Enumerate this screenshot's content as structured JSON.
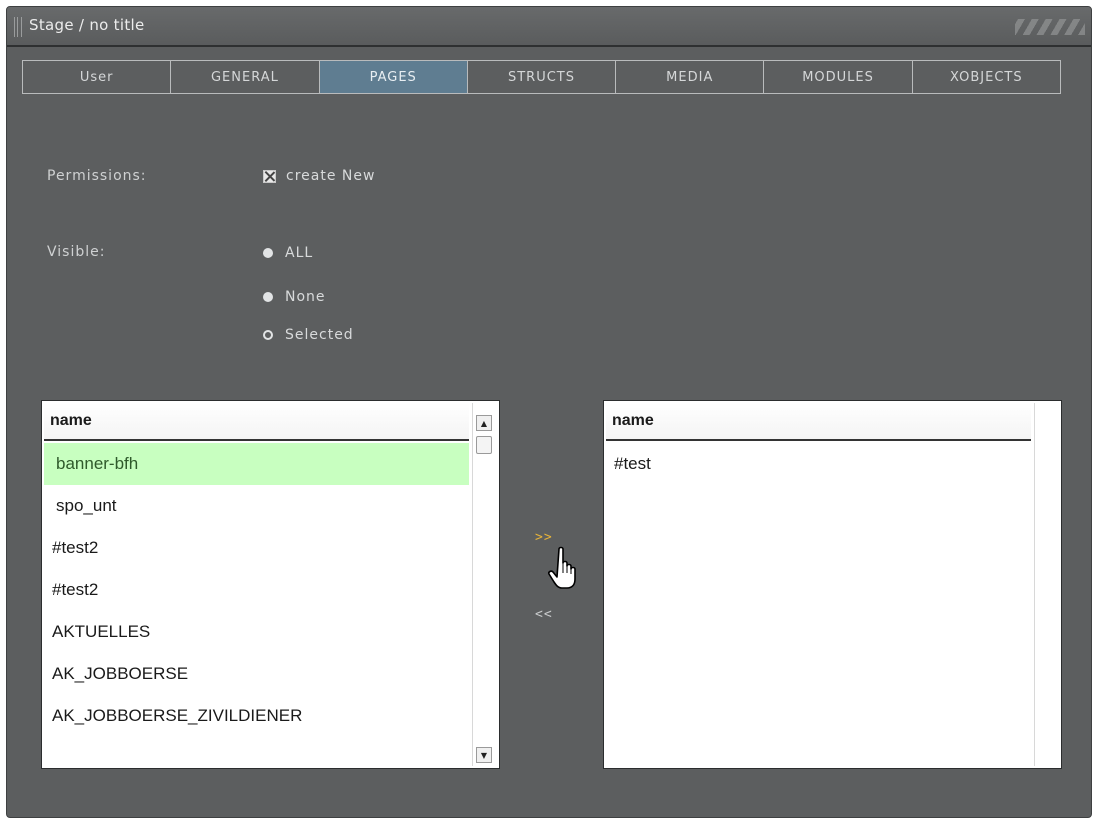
{
  "window": {
    "title": "Stage / no title"
  },
  "tabs": [
    {
      "label": "User",
      "active": false
    },
    {
      "label": "GENERAL",
      "active": false
    },
    {
      "label": "PAGES",
      "active": true
    },
    {
      "label": "STRUCTS",
      "active": false
    },
    {
      "label": "MEDIA",
      "active": false
    },
    {
      "label": "MODULES",
      "active": false
    },
    {
      "label": "XOBJECTS",
      "active": false
    }
  ],
  "permissions": {
    "label": "Permissions:",
    "create_new": {
      "label": "create New",
      "checked": true
    }
  },
  "visible": {
    "label": "Visible:",
    "options": [
      {
        "label": "ALL",
        "selected": false
      },
      {
        "label": "None",
        "selected": false
      },
      {
        "label": "Selected",
        "selected": true
      }
    ]
  },
  "left_list": {
    "header": "name",
    "items": [
      "banner-bfh",
      "spo_unt",
      "#test2",
      "#test2",
      "AKTUELLES",
      "AK_JOBBOERSE",
      "AK_JOBBOERSE_ZIVILDIENER"
    ],
    "selected_index": 0
  },
  "right_list": {
    "header": "name",
    "items": [
      "#test"
    ]
  },
  "transfer": {
    "add_label": ">>",
    "remove_label": "<<"
  },
  "colors": {
    "window_bg": "#5c5e5f",
    "active_tab": "#5f7d91",
    "selected_row": "#c8ffc0",
    "add_arrow": "#e6b33a"
  }
}
